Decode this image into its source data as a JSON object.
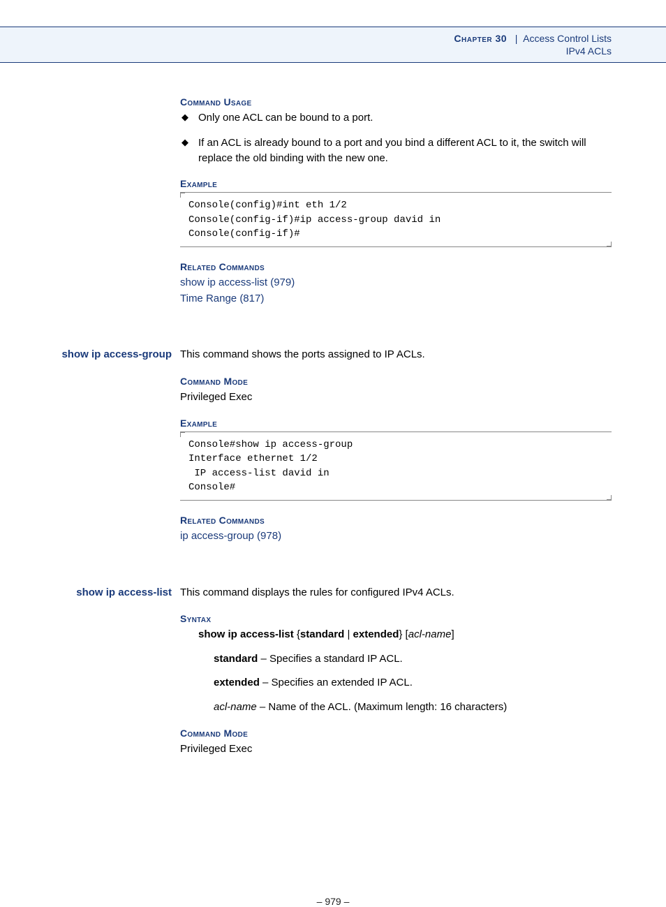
{
  "header": {
    "chapter": "Chapter 30",
    "separator": "|",
    "title": "Access Control Lists",
    "subtitle": "IPv4 ACLs"
  },
  "section1": {
    "cmd_usage_heading": "Command Usage",
    "bullet1": "Only one ACL can be bound to a port.",
    "bullet2": "If an ACL is already bound to a port and you bind a different ACL to it, the switch will replace the old binding with the new one.",
    "example_heading": "Example",
    "code": "Console(config)#int eth 1/2\nConsole(config-if)#ip access-group david in\nConsole(config-if)#",
    "related_heading": "Related Commands",
    "link1": "show ip access-list (979)",
    "link2": "Time Range (817)"
  },
  "section2": {
    "margin_title": "show ip access-group",
    "intro": "This command shows the ports assigned to IP ACLs.",
    "mode_heading": "Command Mode",
    "mode_value": "Privileged Exec",
    "example_heading": "Example",
    "code": "Console#show ip access-group\nInterface ethernet 1/2\n IP access-list david in\nConsole#",
    "related_heading": "Related Commands",
    "link1": "ip access-group (978)"
  },
  "section3": {
    "margin_title": "show ip access-list",
    "intro": "This command displays the rules for configured IPv4 ACLs.",
    "syntax_heading": "Syntax",
    "syntax_cmd_b1": "show ip access-list",
    "syntax_brace_open": " {",
    "syntax_b2": "standard",
    "syntax_pipe": " | ",
    "syntax_b3": "extended",
    "syntax_brace_close": "} [",
    "syntax_ital": "acl-name",
    "syntax_close": "]",
    "standard_b": "standard",
    "standard_desc": " – Specifies a standard IP ACL.",
    "extended_b": "extended",
    "extended_desc": " – Specifies an extended IP ACL.",
    "aclname_i": "acl-name",
    "aclname_desc": " – Name of the ACL. (Maximum length: 16 characters)",
    "mode_heading": "Command Mode",
    "mode_value": "Privileged Exec"
  },
  "footer": {
    "page": "– 979 –"
  }
}
